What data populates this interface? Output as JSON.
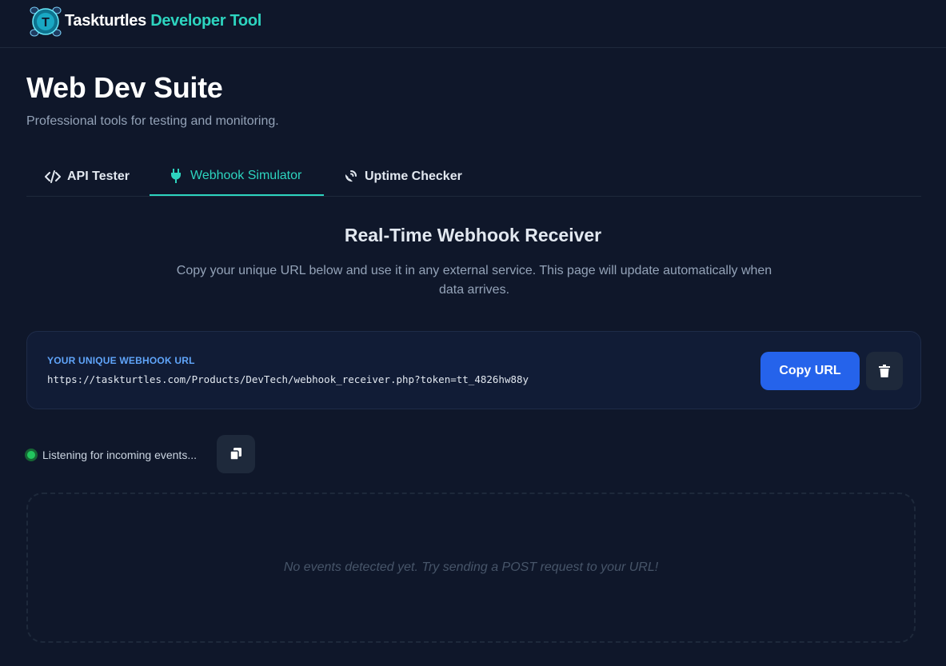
{
  "header": {
    "brand_name": "Taskturtles",
    "brand_suffix": "Developer Tool",
    "logo_letter": "T"
  },
  "page": {
    "title": "Web Dev Suite",
    "subtitle": "Professional tools for testing and monitoring."
  },
  "tabs": [
    {
      "label": "API Tester",
      "icon": "code-icon",
      "active": false
    },
    {
      "label": "Webhook Simulator",
      "icon": "plug-icon",
      "active": true
    },
    {
      "label": "Uptime Checker",
      "icon": "satellite-dish-icon",
      "active": false
    }
  ],
  "webhook": {
    "title": "Real-Time Webhook Receiver",
    "description": "Copy your unique URL below and use it in any external service. This page will update automatically when data arrives.",
    "url_label": "YOUR UNIQUE WEBHOOK URL",
    "url": "https://taskturtles.com/Products/DevTech/webhook_receiver.php?token=tt_4826hw88y",
    "copy_label": "Copy URL",
    "status_text": "Listening for incoming events...",
    "empty_text": "No events detected yet. Try sending a POST request to your URL!"
  },
  "colors": {
    "background": "#0f172a",
    "accent": "#2dd4bf",
    "primary_button": "#2563eb",
    "status_green": "#22c55e",
    "url_label": "#60a5fa"
  }
}
